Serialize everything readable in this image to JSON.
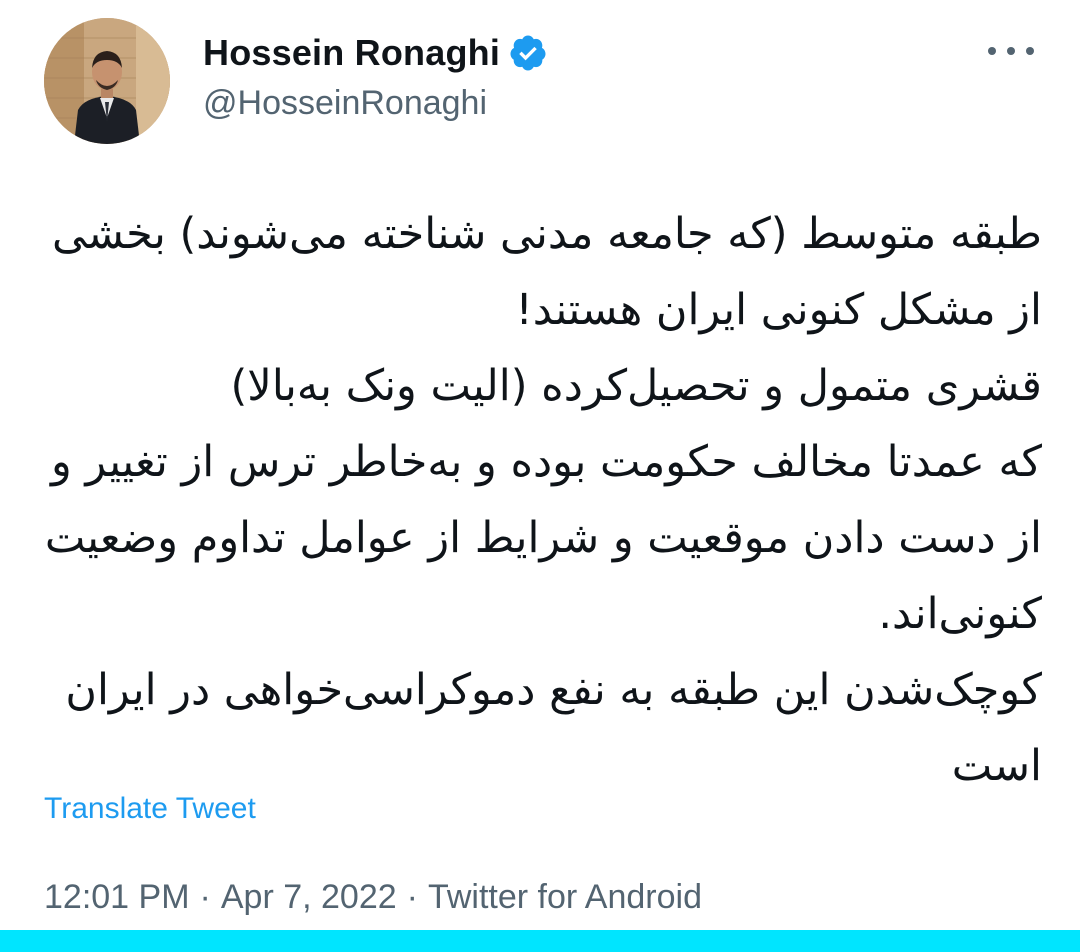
{
  "tweet": {
    "author": {
      "display_name": "Hossein Ronaghi",
      "handle": "@HosseinRonaghi",
      "verified": true,
      "verified_icon": "verified-badge-icon"
    },
    "more_icon": "more-horizontal-icon",
    "text": "طبقه متوسط (که جامعه مدنی شناخته می‌شوند) بخشی از مشکل کنونی ایران هستند!\nقشری متمول و تحصیل‌کرده (الیت ونک به‌بالا)\nکه عمدتا مخالف حکومت بوده و به‌خاطر ترس از تغییر و از دست دادن موقعیت و شرایط از عوامل تداوم وضعیت کنونی‌اند.\nکوچک‌شدن این طبقه به نفع دموکراسی‌خواهی در ایران است",
    "translate_label": "Translate Tweet",
    "time": "12:01 PM",
    "date": "Apr 7, 2022",
    "source": "Twitter for Android",
    "separator": "·"
  },
  "colors": {
    "text": "#0f1419",
    "secondary": "#536471",
    "link": "#1d9bf0",
    "verified": "#1d9bf0",
    "bottom_bar": "#00e5ff"
  }
}
